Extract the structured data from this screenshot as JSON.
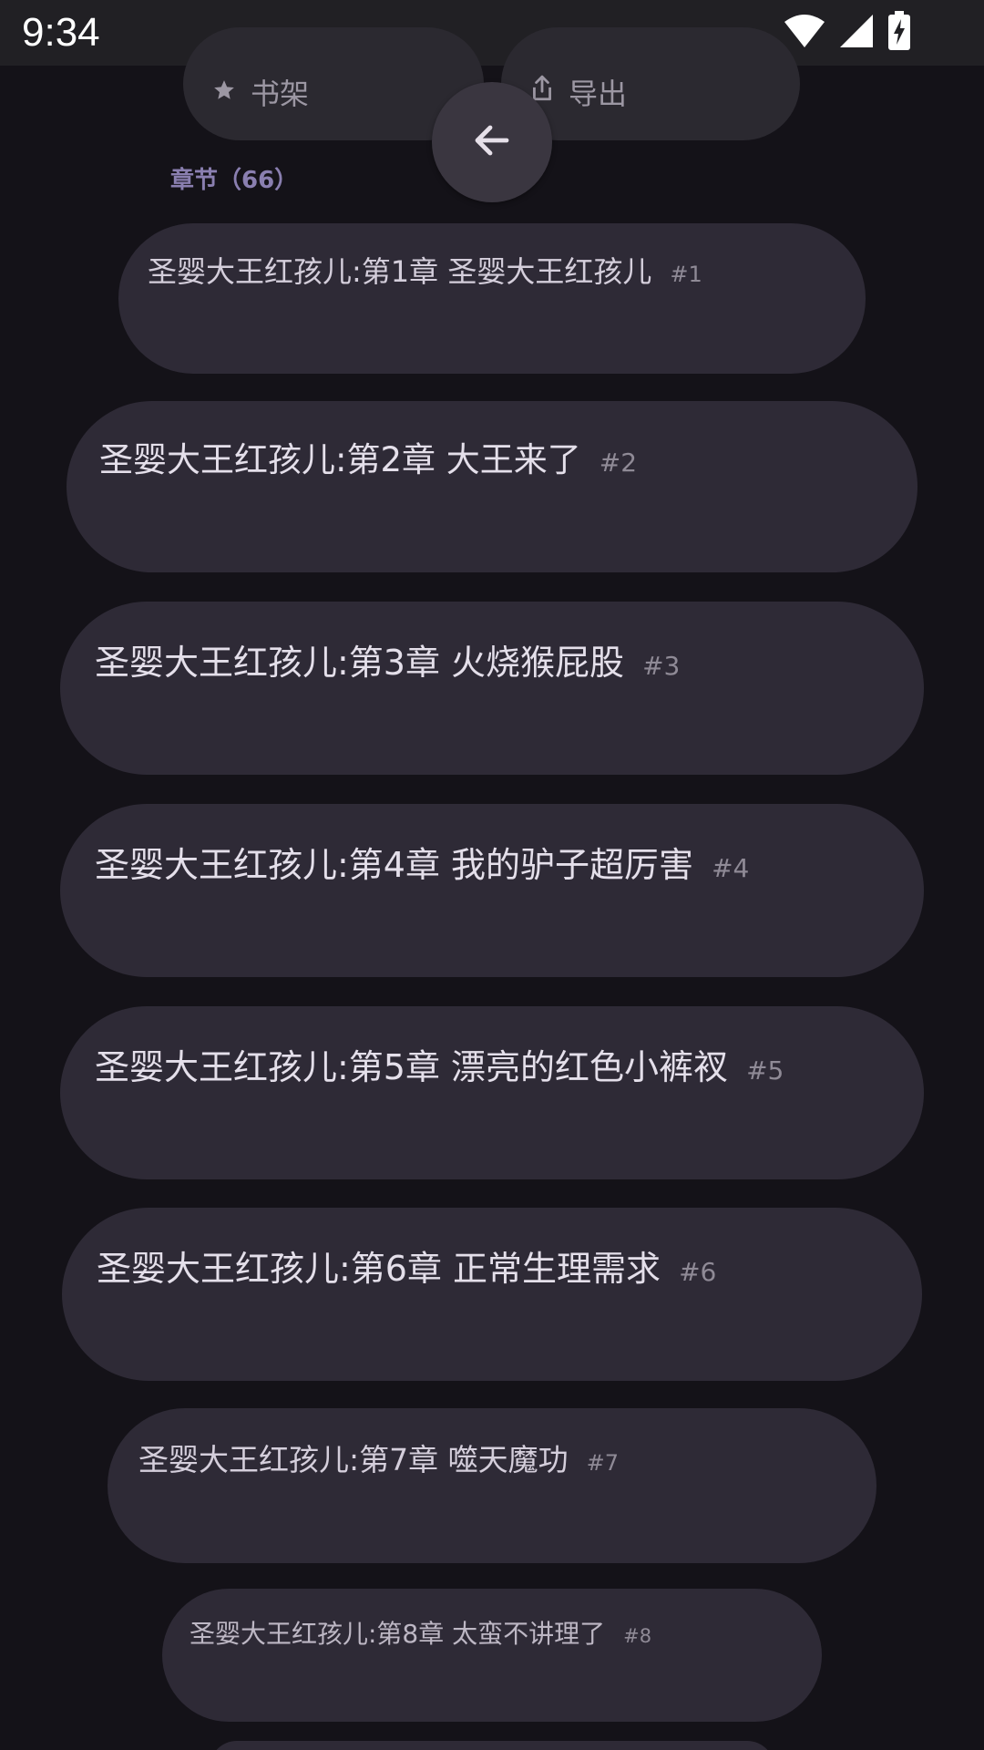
{
  "status_bar": {
    "time": "9:34",
    "icons": [
      "wifi-icon",
      "cell-signal-icon",
      "battery-charging-icon"
    ]
  },
  "actions": {
    "bookshelf_label": "书架",
    "bookshelf_icon": "star-icon",
    "export_label": "导出",
    "export_icon": "share-icon",
    "back_icon": "arrow-left-icon"
  },
  "chapters": {
    "header": "章节（66）",
    "items": [
      {
        "title": "圣婴大王红孩儿:第1章 圣婴大王红孩儿",
        "number": "#1"
      },
      {
        "title": "圣婴大王红孩儿:第2章 大王来了",
        "number": "#2"
      },
      {
        "title": "圣婴大王红孩儿:第3章 火烧猴屁股",
        "number": "#3"
      },
      {
        "title": "圣婴大王红孩儿:第4章 我的驴子超厉害",
        "number": "#4"
      },
      {
        "title": "圣婴大王红孩儿:第5章 漂亮的红色小裤衩",
        "number": "#5"
      },
      {
        "title": "圣婴大王红孩儿:第6章 正常生理需求",
        "number": "#6"
      },
      {
        "title": "圣婴大王红孩儿:第7章 噬天魔功",
        "number": "#7"
      },
      {
        "title": "圣婴大王红孩儿:第8章 太蛮不讲理了",
        "number": "#8"
      }
    ]
  },
  "colors": {
    "background": "#141218",
    "card": "#2e2a36",
    "accent": "#8a7fb0"
  }
}
